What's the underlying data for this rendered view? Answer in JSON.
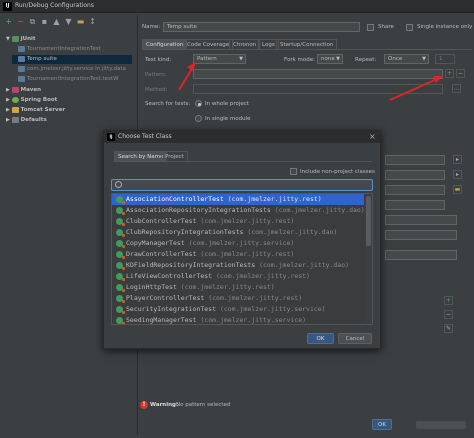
{
  "window": {
    "title": "Run/Debug Configurations",
    "app_logo": "IJ"
  },
  "toolbar": {
    "icons": [
      "add-icon",
      "remove-icon",
      "copy-icon",
      "save-icon",
      "move-up-icon",
      "move-down-icon",
      "folder-icon",
      "sort-icon"
    ]
  },
  "tree": {
    "root": "JUnit",
    "junit_items": [
      "TournamentIntegrationTest",
      "Temp suite",
      "com.jmelzer.jitty.service in jitty.data",
      "TournamentIntegrationTest.testW"
    ],
    "groups": [
      "Maven",
      "Spring Boot",
      "Tomcat Server",
      "Defaults"
    ]
  },
  "config": {
    "name_label": "Name:",
    "name_value": "Temp suite",
    "share_label": "Share",
    "single_instance_label": "Single instance only",
    "tabs": [
      "Configuration",
      "Code Coverage",
      "Chronon",
      "Logs",
      "Startup/Connection"
    ],
    "test_kind_label": "Test kind:",
    "test_kind_value": "Pattern",
    "fork_mode_label": "Fork mode:",
    "fork_mode_value": "none",
    "repeat_label": "Repeat:",
    "repeat_value": "Once",
    "repeat_count": "1",
    "pattern_label": "Pattern:",
    "method_label": "Method:",
    "search_label": "Search for tests:",
    "radio_whole_project": "In whole project",
    "radio_single_module": "In single module",
    "warning_prefix": "Warning:",
    "warning_text": "No pattern selected"
  },
  "dialog": {
    "title": "Choose Test Class",
    "tabs": [
      "Search by Name",
      "Project"
    ],
    "include_label": "Include non-project classes",
    "search_value": "",
    "classes": [
      {
        "name": "AssociationControllerTest",
        "pkg": "(com.jmelzer.jitty.rest)"
      },
      {
        "name": "AssociationRepositoryIntegrationTests",
        "pkg": "(com.jmelzer.jitty.dao)"
      },
      {
        "name": "ClubControllerTest",
        "pkg": "(com.jmelzer.jitty.rest)"
      },
      {
        "name": "ClubRepositoryIntegrationTests",
        "pkg": "(com.jmelzer.jitty.dao)"
      },
      {
        "name": "CopyManagerTest",
        "pkg": "(com.jmelzer.jitty.service)"
      },
      {
        "name": "DrawControllerTest",
        "pkg": "(com.jmelzer.jitty.rest)"
      },
      {
        "name": "KOFieldRepositoryIntegrationTests",
        "pkg": "(com.jmelzer.jitty.dao)"
      },
      {
        "name": "LifeViewControllerTest",
        "pkg": "(com.jmelzer.jitty.rest)"
      },
      {
        "name": "LoginHttpTest",
        "pkg": "(com.jmelzer.jitty.rest)"
      },
      {
        "name": "PlayerControllerTest",
        "pkg": "(com.jmelzer.jitty.rest)"
      },
      {
        "name": "SecurityIntegrationTest",
        "pkg": "(com.jmelzer.jitty.service)"
      },
      {
        "name": "SeedingManagerTest",
        "pkg": "(com.jmelzer.jitty.service)"
      }
    ],
    "ok_label": "OK",
    "cancel_label": "Cancel"
  },
  "footer": {
    "ok_label": "OK"
  },
  "colors": {
    "selection": "#2f65ca",
    "annotation_arrow": "#d92626",
    "warning": "#d9342b"
  }
}
